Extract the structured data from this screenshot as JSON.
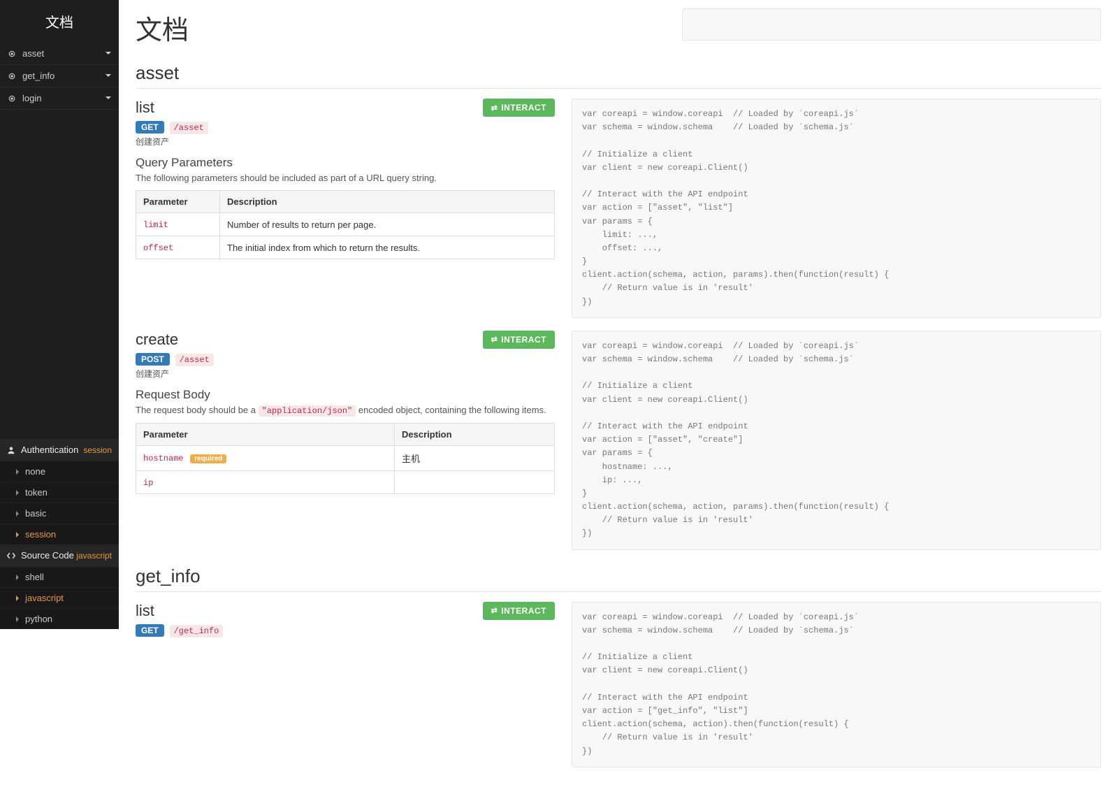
{
  "sidebar": {
    "title": "文档",
    "nav": [
      {
        "label": "asset"
      },
      {
        "label": "get_info"
      },
      {
        "label": "login"
      }
    ],
    "auth": {
      "header": "Authentication",
      "selected": "session",
      "options": [
        "none",
        "token",
        "basic",
        "session"
      ]
    },
    "source": {
      "header": "Source Code",
      "selected": "javascript",
      "options": [
        "shell",
        "javascript",
        "python"
      ]
    }
  },
  "main": {
    "title": "文档",
    "interact_label": "INTERACT",
    "sections": {
      "asset": {
        "heading": "asset",
        "list": {
          "name": "list",
          "method": "GET",
          "path": "/asset",
          "description": "创建资产",
          "queryHeading": "Query Parameters",
          "queryIntro": "The following parameters should be included as part of a URL query string.",
          "paramHeader": "Parameter",
          "descHeader": "Description",
          "params": [
            {
              "name": "limit",
              "desc": "Number of results to return per page."
            },
            {
              "name": "offset",
              "desc": "The initial index from which to return the results."
            }
          ],
          "code": "var coreapi = window.coreapi  // Loaded by `coreapi.js`\nvar schema = window.schema    // Loaded by `schema.js`\n\n// Initialize a client\nvar client = new coreapi.Client()\n\n// Interact with the API endpoint\nvar action = [\"asset\", \"list\"]\nvar params = {\n    limit: ...,\n    offset: ...,\n}\nclient.action(schema, action, params).then(function(result) {\n    // Return value is in 'result'\n})"
        },
        "create": {
          "name": "create",
          "method": "POST",
          "path": "/asset",
          "description": "创建资产",
          "bodyHeading": "Request Body",
          "bodyIntroPrefix": "The request body should be a ",
          "bodyContentType": "\"application/json\"",
          "bodyIntroSuffix": " encoded object, containing the following items.",
          "paramHeader": "Parameter",
          "descHeader": "Description",
          "requiredLabel": "required",
          "params": [
            {
              "name": "hostname",
              "required": true,
              "desc": "主机"
            },
            {
              "name": "ip",
              "required": false,
              "desc": ""
            }
          ],
          "code": "var coreapi = window.coreapi  // Loaded by `coreapi.js`\nvar schema = window.schema    // Loaded by `schema.js`\n\n// Initialize a client\nvar client = new coreapi.Client()\n\n// Interact with the API endpoint\nvar action = [\"asset\", \"create\"]\nvar params = {\n    hostname: ...,\n    ip: ...,\n}\nclient.action(schema, action, params).then(function(result) {\n    // Return value is in 'result'\n})"
        }
      },
      "get_info": {
        "heading": "get_info",
        "list": {
          "name": "list",
          "method": "GET",
          "path": "/get_info",
          "code": "var coreapi = window.coreapi  // Loaded by `coreapi.js`\nvar schema = window.schema    // Loaded by `schema.js`\n\n// Initialize a client\nvar client = new coreapi.Client()\n\n// Interact with the API endpoint\nvar action = [\"get_info\", \"list\"]\nclient.action(schema, action).then(function(result) {\n    // Return value is in 'result'\n})"
        }
      }
    }
  }
}
